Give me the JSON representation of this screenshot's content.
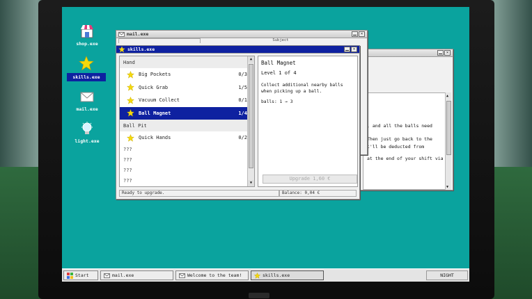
{
  "desktop": {
    "icons": [
      {
        "label": "shop.exe"
      },
      {
        "label": "skills.exe"
      },
      {
        "label": "mail.exe"
      },
      {
        "label": "light.exe"
      }
    ]
  },
  "mail_window": {
    "title": "mail.exe",
    "tab1": "",
    "tab2": "Subject"
  },
  "back_window": {
    "lines": [
      ", and all the balls need",
      "Then just go back to the",
      "t'll be deducted from",
      "at the end of your shift via"
    ]
  },
  "skills_window": {
    "title": "skills.exe",
    "categories": [
      {
        "name": "Hand",
        "skills": [
          {
            "name": "Big Pockets",
            "level": "0/3"
          },
          {
            "name": "Quick Grab",
            "level": "1/5"
          },
          {
            "name": "Vacuum Collect",
            "level": "0/1"
          },
          {
            "name": "Ball Magnet",
            "level": "1/4"
          }
        ]
      },
      {
        "name": "Ball Pit",
        "skills": [
          {
            "name": "Quick Hands",
            "level": "0/2"
          }
        ]
      }
    ],
    "locked": [
      "???",
      "???",
      "???",
      "???"
    ],
    "detail": {
      "title": "Ball Magnet",
      "level": "Level 1 of 4",
      "description": "Collect additional nearby balls when picking up a ball.",
      "stat": "balls:  1 → 3",
      "upgrade_label": "Upgrade  1,60 €"
    },
    "status": "Ready to upgrade.",
    "balance": "Balance: 0,04 €"
  },
  "taskbar": {
    "start": "Start",
    "items": [
      "mail.exe",
      "Welcome to the team!",
      "skills.exe"
    ],
    "clock": "NIGHT"
  },
  "colors": {
    "desktop": "#0aa39e",
    "selection": "#0e21a0",
    "star": "#f5d90c"
  }
}
